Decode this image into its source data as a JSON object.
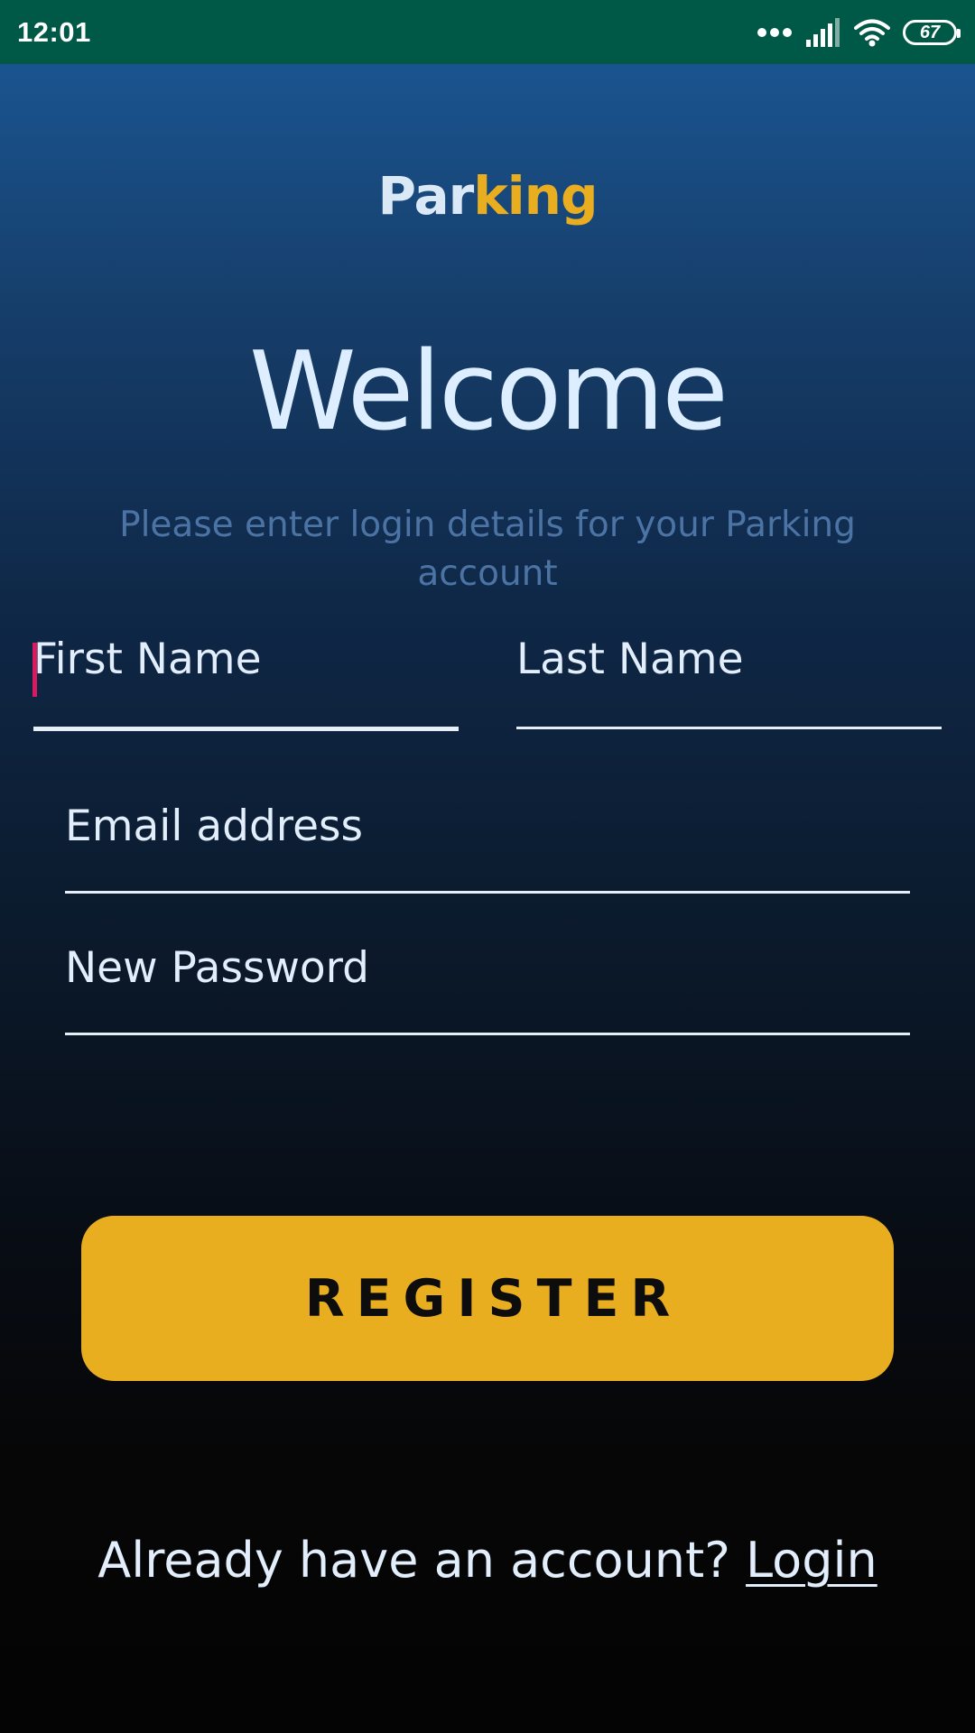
{
  "status_bar": {
    "time": "12:01",
    "battery_level": "67",
    "icons": [
      "more-dots-icon",
      "signal-icon",
      "wifi-icon",
      "battery-icon"
    ]
  },
  "logo": {
    "part1": "Par",
    "part2": "king"
  },
  "welcome": {
    "title": "Welcome",
    "subtitle": "Please enter login details for your Parking account"
  },
  "form": {
    "first_name": "First Name",
    "last_name": "Last Name",
    "email": "Email address",
    "password": "New Password"
  },
  "register_label": "REGISTER",
  "footer": {
    "prompt": "Already have an account? ",
    "login_link": "Login"
  },
  "colors": {
    "status_bar_bg": "#005846",
    "accent": "#e8ae20",
    "text": "#e2eefb",
    "subtitle": "#4b73a4",
    "cursor": "#d81b60"
  }
}
